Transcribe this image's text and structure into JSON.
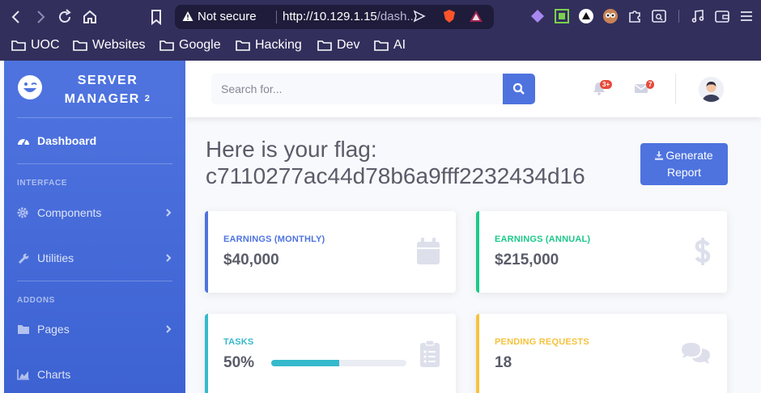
{
  "browser": {
    "not_secure": "Not secure",
    "url_host": "http://10.129.1.15",
    "url_path": "/dash...",
    "bookmarks": [
      "UOC",
      "Websites",
      "Google",
      "Hacking",
      "Dev",
      "AI"
    ]
  },
  "sidebar": {
    "brand_line1": "SERVER",
    "brand_line2": "MANAGER",
    "brand_sup": "2",
    "dashboard": "Dashboard",
    "heading_interface": "INTERFACE",
    "components": "Components",
    "utilities": "Utilities",
    "heading_addons": "ADDONS",
    "pages": "Pages",
    "charts": "Charts"
  },
  "topbar": {
    "search_placeholder": "Search for...",
    "alerts_badge": "3+",
    "messages_badge": "7"
  },
  "main": {
    "flag_line1": "Here is your flag:",
    "flag_line2": "c7110277ac44d78b6a9fff2232434d16",
    "generate_label_1": "Generate",
    "generate_label_2": "Report"
  },
  "cards": [
    {
      "title": "EARNINGS (MONTHLY)",
      "value": "$40,000",
      "color": "#4e73df",
      "icon": "calendar-icon"
    },
    {
      "title": "EARNINGS (ANNUAL)",
      "value": "$215,000",
      "color": "#1cc88a",
      "icon": "dollar-icon"
    },
    {
      "title": "TASKS",
      "value": "50%",
      "progress": 50,
      "color": "#36b9cc",
      "icon": "clipboard-list-icon"
    },
    {
      "title": "PENDING REQUESTS",
      "value": "18",
      "color": "#f6c23e",
      "icon": "comments-icon"
    }
  ],
  "colors": {
    "primary": "#4e73df",
    "success": "#1cc88a",
    "info": "#36b9cc",
    "warning": "#f6c23e",
    "danger": "#e74a3b",
    "browser_chrome": "#322f5c"
  }
}
